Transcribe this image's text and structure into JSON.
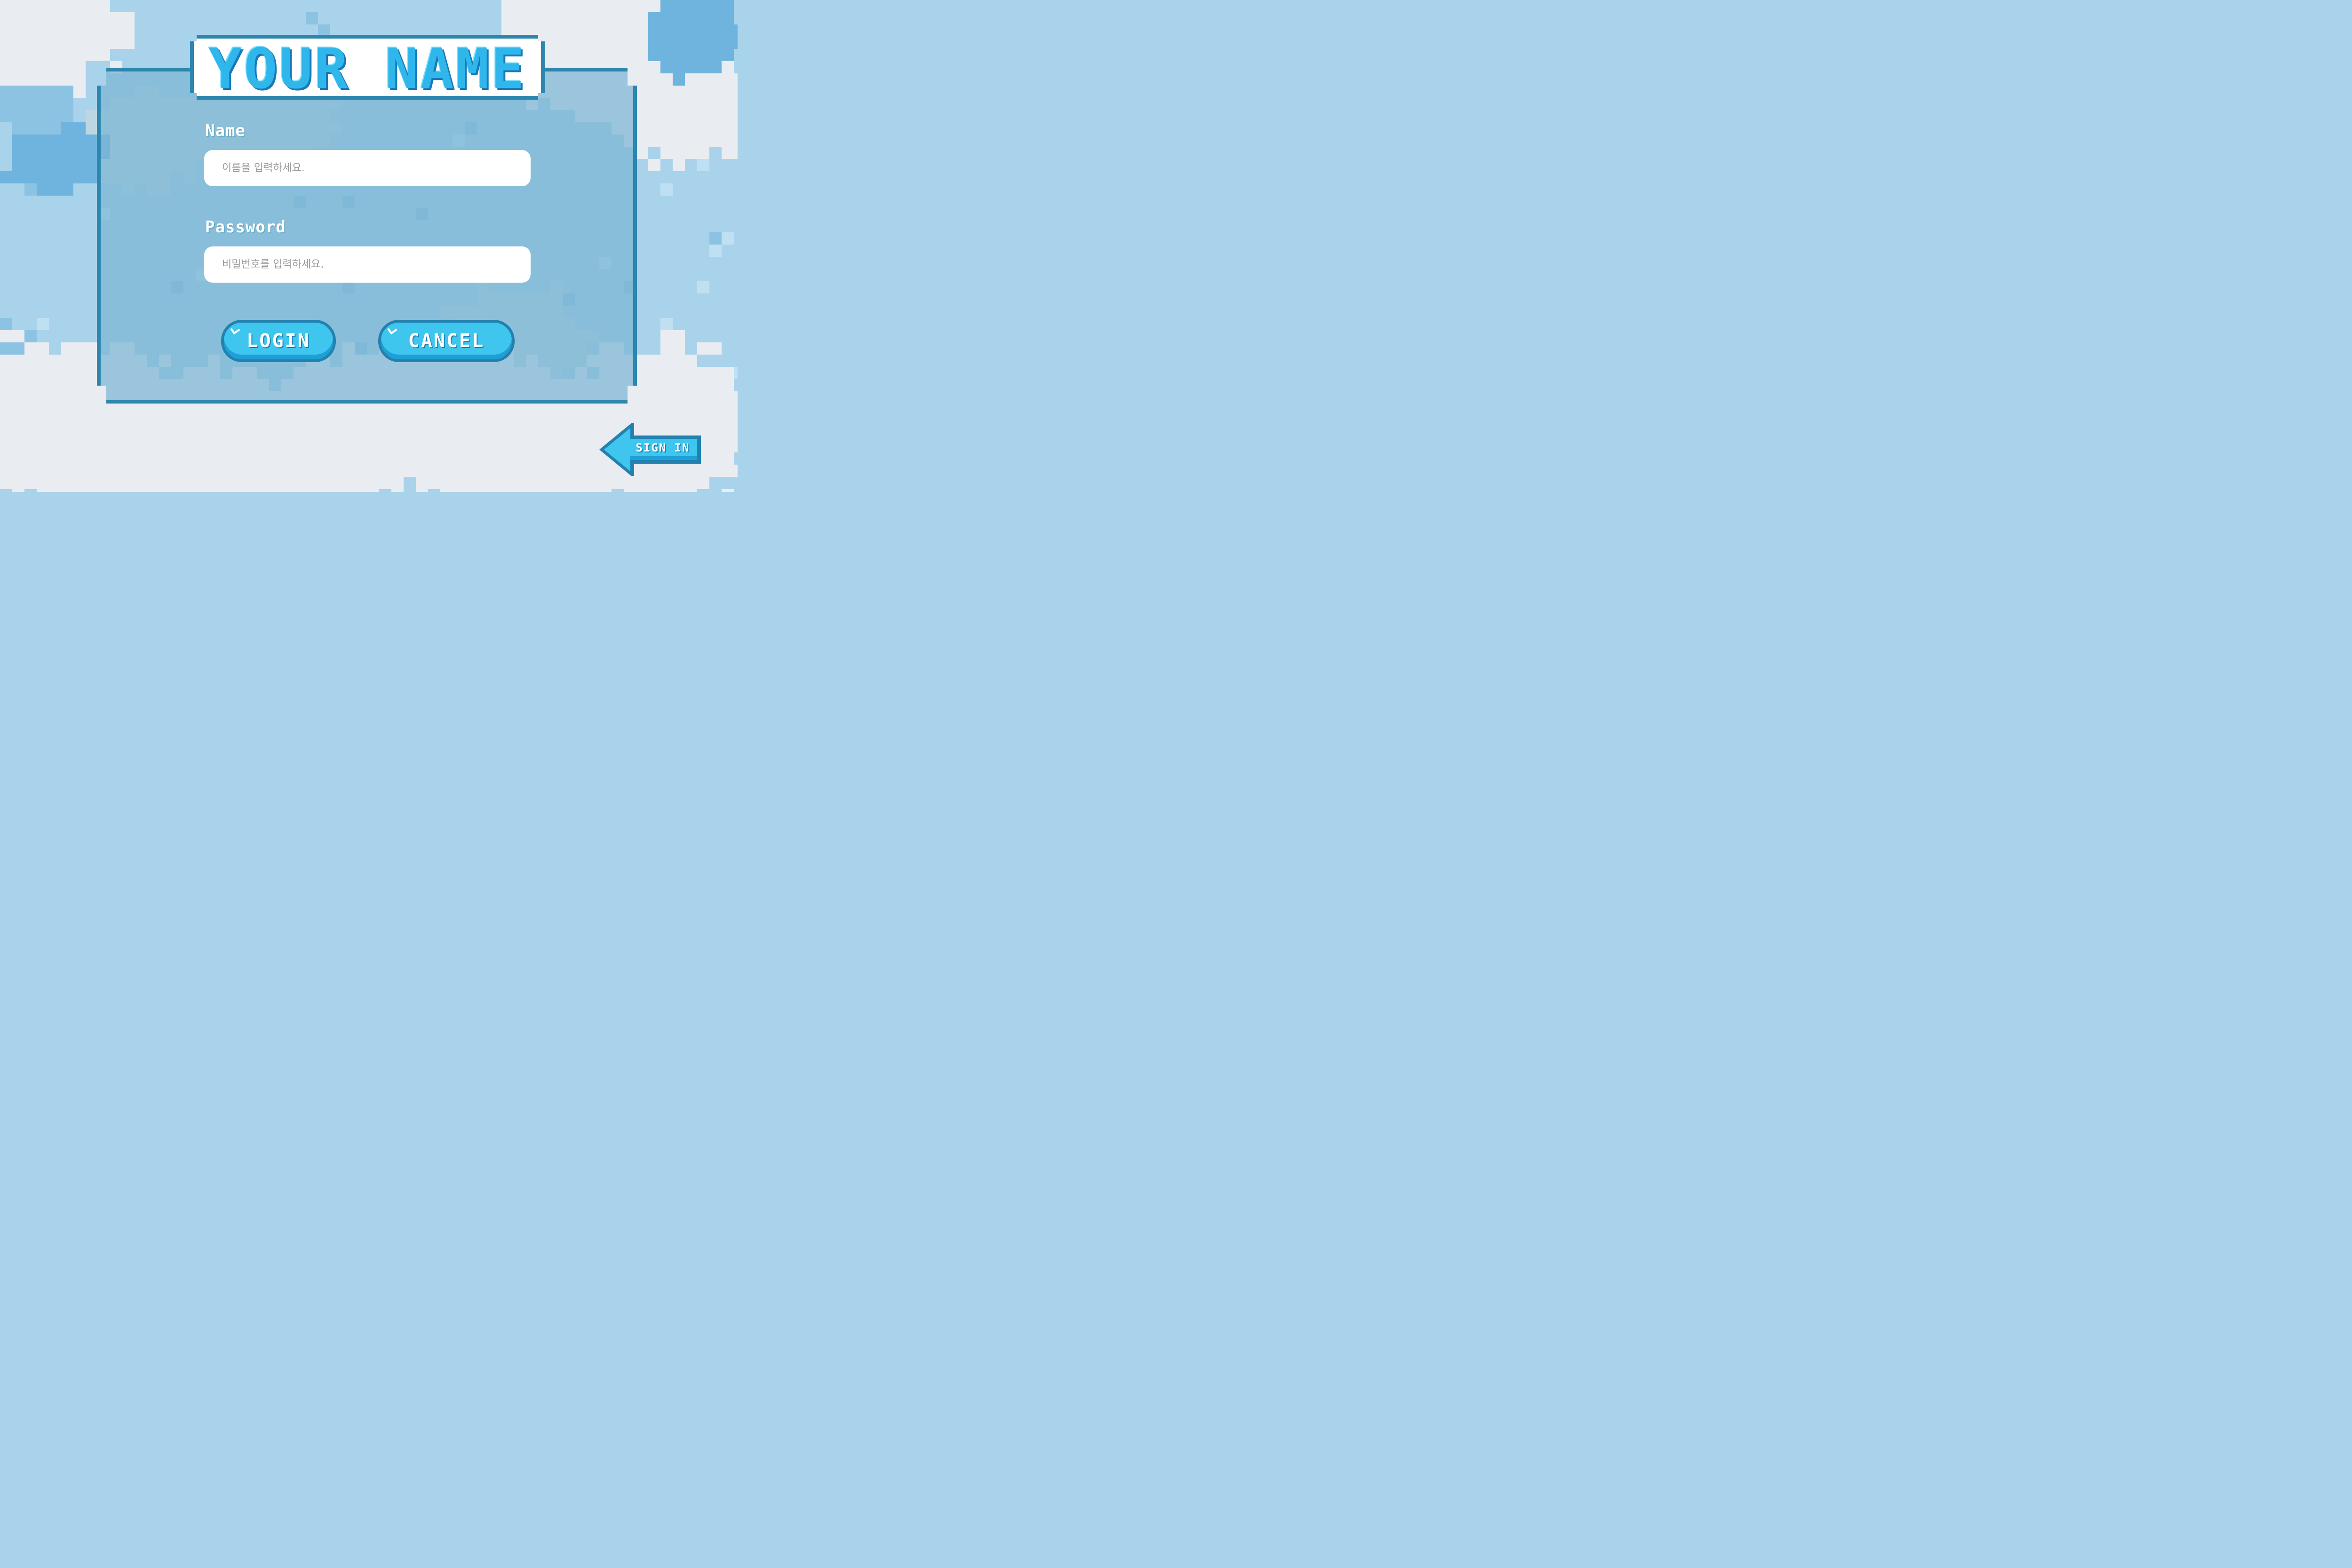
{
  "title": "YOUR NAME",
  "form": {
    "name_label": "Name",
    "name_placeholder": "이름을 입력하세요.",
    "password_label": "Password",
    "password_placeholder": "비밀번호를 입력하세요."
  },
  "buttons": {
    "login": "LOGIN",
    "cancel": "CANCEL",
    "sign_in": "SIGN IN"
  },
  "colors": {
    "sky": "#a9d3ea",
    "cloud": "#e9ecf0",
    "frame": "#2c86ad",
    "button": "#3ec6ef",
    "title_fill": "#2fb7ec"
  }
}
